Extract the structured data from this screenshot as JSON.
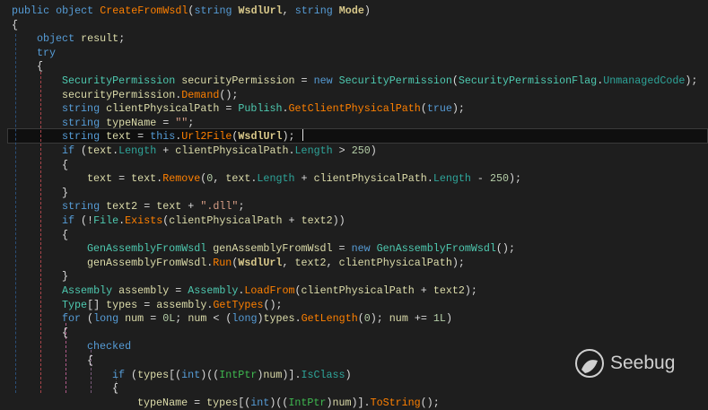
{
  "lines": [
    [
      0,
      [
        [
          "k",
          "public"
        ],
        [
          "o",
          " "
        ],
        [
          "k",
          "object"
        ],
        [
          "o",
          " "
        ],
        [
          "m",
          "CreateFromWsdl"
        ],
        [
          "o",
          "("
        ],
        [
          "k",
          "string"
        ],
        [
          "o",
          " "
        ],
        [
          "p",
          "WsdlUrl"
        ],
        [
          "o",
          ", "
        ],
        [
          "k",
          "string"
        ],
        [
          "o",
          " "
        ],
        [
          "p",
          "Mode"
        ],
        [
          "o",
          ")"
        ]
      ]
    ],
    [
      0,
      [
        [
          "o",
          "{"
        ]
      ]
    ],
    [
      4,
      [
        [
          "k",
          "object"
        ],
        [
          "o",
          " "
        ],
        [
          "v",
          "result"
        ],
        [
          "o",
          ";"
        ]
      ]
    ],
    [
      4,
      [
        [
          "k",
          "try"
        ]
      ]
    ],
    [
      4,
      [
        [
          "o",
          "{"
        ]
      ]
    ],
    [
      8,
      [
        [
          "t",
          "SecurityPermission"
        ],
        [
          "o",
          " "
        ],
        [
          "v",
          "securityPermission"
        ],
        [
          "o",
          " = "
        ],
        [
          "k",
          "new"
        ],
        [
          "o",
          " "
        ],
        [
          "t",
          "SecurityPermission"
        ],
        [
          "o",
          "("
        ],
        [
          "t",
          "SecurityPermissionFlag"
        ],
        [
          "o",
          "."
        ],
        [
          "pr",
          "UnmanagedCode"
        ],
        [
          "o",
          ");"
        ]
      ]
    ],
    [
      8,
      [
        [
          "v",
          "securityPermission"
        ],
        [
          "o",
          "."
        ],
        [
          "m",
          "Demand"
        ],
        [
          "o",
          "();"
        ]
      ]
    ],
    [
      8,
      [
        [
          "k",
          "string"
        ],
        [
          "o",
          " "
        ],
        [
          "v",
          "clientPhysicalPath"
        ],
        [
          "o",
          " = "
        ],
        [
          "t",
          "Publish"
        ],
        [
          "o",
          "."
        ],
        [
          "m",
          "GetClientPhysicalPath"
        ],
        [
          "o",
          "("
        ],
        [
          "k",
          "true"
        ],
        [
          "o",
          ");"
        ]
      ]
    ],
    [
      8,
      [
        [
          "k",
          "string"
        ],
        [
          "o",
          " "
        ],
        [
          "v",
          "typeName"
        ],
        [
          "o",
          " = "
        ],
        [
          "s",
          "\"\""
        ],
        [
          "o",
          ";"
        ]
      ]
    ],
    [
      8,
      [
        [
          "k",
          "string"
        ],
        [
          "o",
          " "
        ],
        [
          "v",
          "text"
        ],
        [
          "o",
          " = "
        ],
        [
          "k",
          "this"
        ],
        [
          "o",
          "."
        ],
        [
          "m",
          "Url2File"
        ],
        [
          "o",
          "("
        ],
        [
          "p",
          "WsdlUrl"
        ],
        [
          "o",
          ");"
        ]
      ]
    ],
    [
      8,
      [
        [
          "k",
          "if"
        ],
        [
          "o",
          " ("
        ],
        [
          "v",
          "text"
        ],
        [
          "o",
          "."
        ],
        [
          "pr",
          "Length"
        ],
        [
          "o",
          " + "
        ],
        [
          "v",
          "clientPhysicalPath"
        ],
        [
          "o",
          "."
        ],
        [
          "pr",
          "Length"
        ],
        [
          "o",
          " > "
        ],
        [
          "n",
          "250"
        ],
        [
          "o",
          ")"
        ]
      ]
    ],
    [
      8,
      [
        [
          "o",
          "{"
        ]
      ]
    ],
    [
      12,
      [
        [
          "v",
          "text"
        ],
        [
          "o",
          " = "
        ],
        [
          "v",
          "text"
        ],
        [
          "o",
          "."
        ],
        [
          "m",
          "Remove"
        ],
        [
          "o",
          "("
        ],
        [
          "n",
          "0"
        ],
        [
          "o",
          ", "
        ],
        [
          "v",
          "text"
        ],
        [
          "o",
          "."
        ],
        [
          "pr",
          "Length"
        ],
        [
          "o",
          " + "
        ],
        [
          "v",
          "clientPhysicalPath"
        ],
        [
          "o",
          "."
        ],
        [
          "pr",
          "Length"
        ],
        [
          "o",
          " - "
        ],
        [
          "n",
          "250"
        ],
        [
          "o",
          ");"
        ]
      ]
    ],
    [
      8,
      [
        [
          "o",
          "}"
        ]
      ]
    ],
    [
      8,
      [
        [
          "k",
          "string"
        ],
        [
          "o",
          " "
        ],
        [
          "v",
          "text2"
        ],
        [
          "o",
          " = "
        ],
        [
          "v",
          "text"
        ],
        [
          "o",
          " + "
        ],
        [
          "s",
          "\".dll\""
        ],
        [
          "o",
          ";"
        ]
      ]
    ],
    [
      8,
      [
        [
          "k",
          "if"
        ],
        [
          "o",
          " (!"
        ],
        [
          "t",
          "File"
        ],
        [
          "o",
          "."
        ],
        [
          "m",
          "Exists"
        ],
        [
          "o",
          "("
        ],
        [
          "v",
          "clientPhysicalPath"
        ],
        [
          "o",
          " + "
        ],
        [
          "v",
          "text2"
        ],
        [
          "o",
          "))"
        ]
      ]
    ],
    [
      8,
      [
        [
          "o",
          "{"
        ]
      ]
    ],
    [
      12,
      [
        [
          "t",
          "GenAssemblyFromWsdl"
        ],
        [
          "o",
          " "
        ],
        [
          "v",
          "genAssemblyFromWsdl"
        ],
        [
          "o",
          " = "
        ],
        [
          "k",
          "new"
        ],
        [
          "o",
          " "
        ],
        [
          "t",
          "GenAssemblyFromWsdl"
        ],
        [
          "o",
          "();"
        ]
      ]
    ],
    [
      12,
      [
        [
          "v",
          "genAssemblyFromWsdl"
        ],
        [
          "o",
          "."
        ],
        [
          "m",
          "Run"
        ],
        [
          "o",
          "("
        ],
        [
          "p",
          "WsdlUrl"
        ],
        [
          "o",
          ", "
        ],
        [
          "v",
          "text2"
        ],
        [
          "o",
          ", "
        ],
        [
          "v",
          "clientPhysicalPath"
        ],
        [
          "o",
          ");"
        ]
      ]
    ],
    [
      8,
      [
        [
          "o",
          "}"
        ]
      ]
    ],
    [
      8,
      [
        [
          "t",
          "Assembly"
        ],
        [
          "o",
          " "
        ],
        [
          "v",
          "assembly"
        ],
        [
          "o",
          " = "
        ],
        [
          "t",
          "Assembly"
        ],
        [
          "o",
          "."
        ],
        [
          "m",
          "LoadFrom"
        ],
        [
          "o",
          "("
        ],
        [
          "v",
          "clientPhysicalPath"
        ],
        [
          "o",
          " + "
        ],
        [
          "v",
          "text2"
        ],
        [
          "o",
          ");"
        ]
      ]
    ],
    [
      8,
      [
        [
          "t",
          "Type"
        ],
        [
          "o",
          "[] "
        ],
        [
          "v",
          "types"
        ],
        [
          "o",
          " = "
        ],
        [
          "v",
          "assembly"
        ],
        [
          "o",
          "."
        ],
        [
          "m",
          "GetTypes"
        ],
        [
          "o",
          "();"
        ]
      ]
    ],
    [
      8,
      [
        [
          "k",
          "for"
        ],
        [
          "o",
          " ("
        ],
        [
          "k",
          "long"
        ],
        [
          "o",
          " "
        ],
        [
          "v",
          "num"
        ],
        [
          "o",
          " = "
        ],
        [
          "n",
          "0L"
        ],
        [
          "o",
          "; "
        ],
        [
          "v",
          "num"
        ],
        [
          "o",
          " < ("
        ],
        [
          "k",
          "long"
        ],
        [
          "o",
          ")"
        ],
        [
          "v",
          "types"
        ],
        [
          "o",
          "."
        ],
        [
          "m",
          "GetLength"
        ],
        [
          "o",
          "("
        ],
        [
          "n",
          "0"
        ],
        [
          "o",
          "); "
        ],
        [
          "v",
          "num"
        ],
        [
          "o",
          " += "
        ],
        [
          "n",
          "1L"
        ],
        [
          "o",
          ")"
        ]
      ]
    ],
    [
      8,
      [
        [
          "o",
          "{"
        ]
      ]
    ],
    [
      12,
      [
        [
          "k",
          "checked"
        ]
      ]
    ],
    [
      12,
      [
        [
          "o",
          "{"
        ]
      ]
    ],
    [
      16,
      [
        [
          "k",
          "if"
        ],
        [
          "o",
          " ("
        ],
        [
          "v",
          "types"
        ],
        [
          "o",
          "[("
        ],
        [
          "k",
          "int"
        ],
        [
          "o",
          ")(("
        ],
        [
          "g",
          "IntPtr"
        ],
        [
          "o",
          ")"
        ],
        [
          "v",
          "num"
        ],
        [
          "o",
          ")]."
        ],
        [
          "pr",
          "IsClass"
        ],
        [
          "o",
          ")"
        ]
      ]
    ],
    [
      16,
      [
        [
          "o",
          "{"
        ]
      ]
    ],
    [
      20,
      [
        [
          "v",
          "typeName"
        ],
        [
          "o",
          " = "
        ],
        [
          "v",
          "types"
        ],
        [
          "o",
          "[("
        ],
        [
          "k",
          "int"
        ],
        [
          "o",
          ")(("
        ],
        [
          "g",
          "IntPtr"
        ],
        [
          "o",
          ")"
        ],
        [
          "v",
          "num"
        ],
        [
          "o",
          ")]."
        ],
        [
          "m",
          "ToString"
        ],
        [
          "o",
          "();"
        ]
      ]
    ]
  ],
  "watermark": "Seebug"
}
